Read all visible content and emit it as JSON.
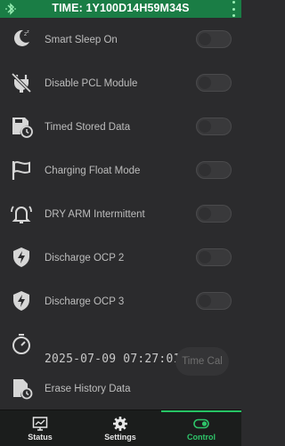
{
  "header": {
    "title": "TIME: 1Y100D14H59M34S"
  },
  "settings": [
    {
      "label": "Smart Sleep On",
      "icon": "sleep-icon",
      "enabled": false
    },
    {
      "label": "Disable PCL Module",
      "icon": "plug-off-icon",
      "enabled": false
    },
    {
      "label": "Timed Stored Data",
      "icon": "save-clock-icon",
      "enabled": false
    },
    {
      "label": "Charging Float Mode",
      "icon": "flag-icon",
      "enabled": false
    },
    {
      "label": "DRY ARM Intermittent",
      "icon": "alarm-bell-icon",
      "enabled": false
    },
    {
      "label": "Discharge OCP 2",
      "icon": "shield-bolt-icon",
      "enabled": false
    },
    {
      "label": "Discharge OCP 3",
      "icon": "shield-bolt-icon",
      "enabled": false
    }
  ],
  "time_calibration": {
    "datetime": "2025-07-09 07:27:01",
    "button_label": "Time Cal",
    "icon": "timer-icon"
  },
  "erase_history": {
    "label": "Erase History Data",
    "icon": "erase-history-icon"
  },
  "bottom_nav": {
    "items": [
      {
        "label": "Status",
        "icon": "monitor-chart-icon",
        "active": false
      },
      {
        "label": "Settings",
        "icon": "gear-icon",
        "active": false
      },
      {
        "label": "Control",
        "icon": "toggle-icon",
        "active": true
      }
    ]
  },
  "colors": {
    "header_bg": "#1a7d45",
    "accent": "#2ec56a",
    "background": "#2b2b2d"
  }
}
